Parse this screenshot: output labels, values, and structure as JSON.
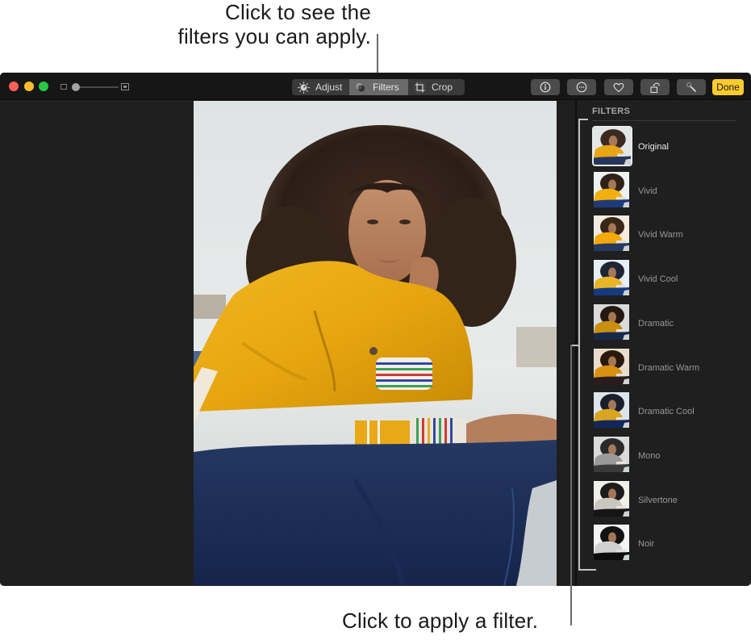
{
  "callouts": {
    "top_line1": "Click to see the",
    "top_line2": "filters you can apply.",
    "bottom": "Click to apply a filter."
  },
  "window": {
    "traffic_lights": [
      "close",
      "minimize",
      "zoom"
    ],
    "zoom_slider": {
      "value": 0.0
    },
    "toolbar": {
      "segments": [
        {
          "label": "Adjust",
          "icon": "adjust-dial-icon",
          "active": false
        },
        {
          "label": "Filters",
          "icon": "filters-circles-icon",
          "active": true
        },
        {
          "label": "Crop",
          "icon": "crop-icon",
          "active": false
        }
      ],
      "tools": [
        {
          "name": "info",
          "icon": "info-icon"
        },
        {
          "name": "more",
          "icon": "ellipsis-icon"
        },
        {
          "name": "favorite",
          "icon": "heart-icon"
        },
        {
          "name": "rotate",
          "icon": "rotate-icon"
        },
        {
          "name": "enhance",
          "icon": "magic-wand-icon"
        }
      ],
      "done_label": "Done"
    },
    "colors": {
      "done_yellow": "#fecb2f",
      "close_red": "#fe5f57",
      "minimize_yellow": "#febc2e",
      "zoom_green": "#28c840"
    }
  },
  "sidebar": {
    "title": "FILTERS",
    "selected": "Original",
    "filters": [
      {
        "label": "Original",
        "tone": "original"
      },
      {
        "label": "Vivid",
        "tone": "vivid"
      },
      {
        "label": "Vivid Warm",
        "tone": "vivid-warm"
      },
      {
        "label": "Vivid Cool",
        "tone": "vivid-cool"
      },
      {
        "label": "Dramatic",
        "tone": "dramatic"
      },
      {
        "label": "Dramatic Warm",
        "tone": "dramatic-warm"
      },
      {
        "label": "Dramatic Cool",
        "tone": "dramatic-cool"
      },
      {
        "label": "Mono",
        "tone": "mono"
      },
      {
        "label": "Silvertone",
        "tone": "silvertone"
      },
      {
        "label": "Noir",
        "tone": "noir"
      }
    ]
  }
}
